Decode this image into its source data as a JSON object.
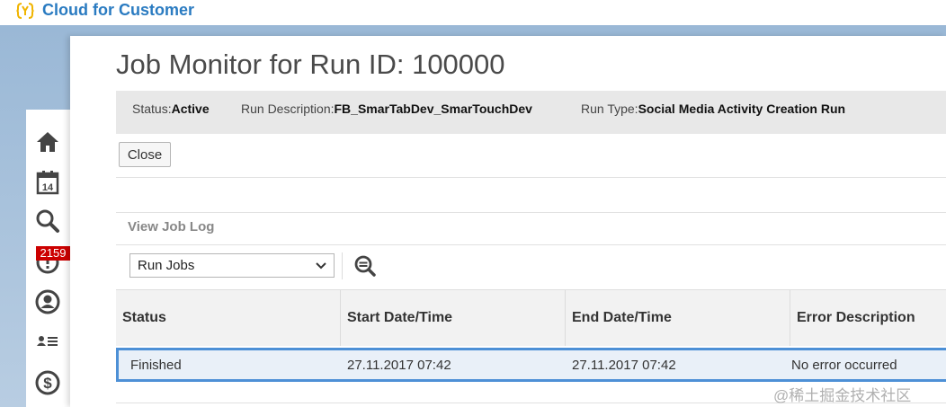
{
  "header": {
    "brand": "Cloud for Customer",
    "logo_icon": "bracket-y-logo"
  },
  "sidebar": {
    "items": [
      {
        "name": "home-icon"
      },
      {
        "name": "calendar-icon",
        "text": "14"
      },
      {
        "name": "search-icon"
      },
      {
        "name": "notification-icon"
      },
      {
        "name": "user-icon"
      },
      {
        "name": "team-list-icon"
      },
      {
        "name": "dollar-icon"
      }
    ],
    "badge": "2159"
  },
  "page": {
    "title": "Job Monitor for Run ID: 100000",
    "status_label": "Status:",
    "status_value": "Active",
    "run_desc_label": "Run Description:",
    "run_desc_value": "FB_SmarTabDev_SmarTouchDev",
    "run_type_label": "Run Type:",
    "run_type_value": "Social Media Activity Creation Run",
    "close_label": "Close"
  },
  "job_log": {
    "section_title": "View Job Log",
    "select_value": "Run Jobs",
    "columns": [
      "Status",
      "Start Date/Time",
      "End Date/Time",
      "Error Description"
    ],
    "rows": [
      {
        "status": "Finished",
        "start": "27.11.2017 07:42",
        "end": "27.11.2017 07:42",
        "error": "No error occurred"
      }
    ]
  },
  "watermark": "@稀土掘金技术社区",
  "colors": {
    "brand": "#2a7bc1",
    "badge": "#cc0000",
    "selection_border": "#4d90d6",
    "icon": "#444444"
  }
}
